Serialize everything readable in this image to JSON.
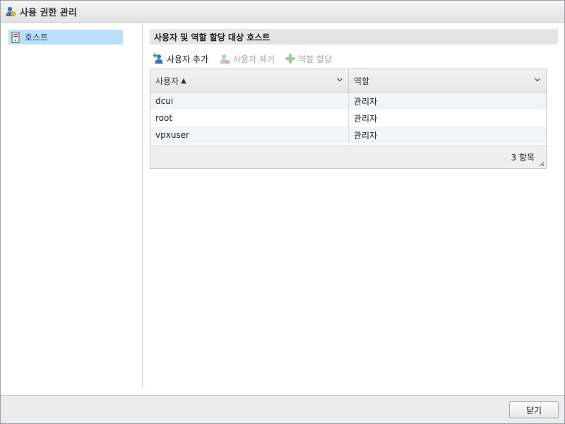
{
  "window": {
    "title": "사용 권한 관리",
    "title_icon": "user-permission-icon"
  },
  "sidebar": {
    "items": [
      {
        "label": "호스트",
        "icon": "host-icon",
        "selected": true
      }
    ]
  },
  "main": {
    "section_title": "사용자 및 역할 할당 대상 호스트",
    "toolbar": {
      "add_user": {
        "label": "사용자 추가",
        "icon": "add-user-icon",
        "enabled": true
      },
      "remove_user": {
        "label": "사용자 제거",
        "icon": "remove-user-icon",
        "enabled": false
      },
      "assign_role": {
        "label": "역할 할당",
        "icon": "plus-icon",
        "enabled": false
      }
    },
    "grid": {
      "columns": [
        {
          "label": "사용자",
          "sort_indicator": "▲"
        },
        {
          "label": "역할",
          "sort_indicator": ""
        }
      ],
      "rows": [
        {
          "user": "dcui",
          "role": "관리자"
        },
        {
          "user": "root",
          "role": "관리자"
        },
        {
          "user": "vpxuser",
          "role": "관리자"
        }
      ],
      "footer_count": "3 항목"
    }
  },
  "footer": {
    "close_label": "닫기"
  },
  "colors": {
    "selection": "#b9dffa",
    "section_header_bg": "#e4e4e4",
    "alt_row": "#f2f4f7"
  }
}
